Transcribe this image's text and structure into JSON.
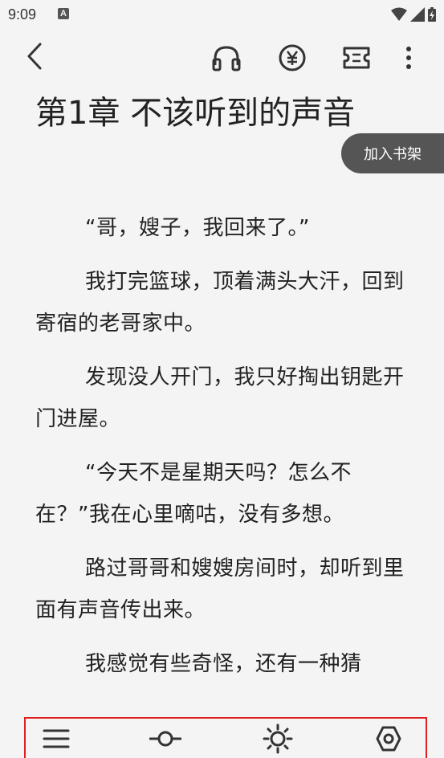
{
  "status": {
    "time": "9:09",
    "a_badge": "A"
  },
  "toolbar": {
    "back_icon": "chevron-left-icon",
    "listen_icon": "headphones-icon",
    "reward_icon": "yuan-coin-icon",
    "ticket_icon": "ticket-icon",
    "more_icon": "more-vertical-icon"
  },
  "chapter": {
    "title": "第1章 不该听到的声音",
    "add_to_shelf": "加入书架",
    "paragraphs": [
      "“哥，嫂子，我回来了。”",
      "我打完篮球，顶着满头大汗，回到寄宿的老哥家中。",
      "发现没人开门，我只好掏出钥匙开门进屋。",
      "“今天不是星期天吗？怎么不在？”我在心里嘀咕，没有多想。",
      "路过哥哥和嫂嫂房间时，却听到里面有声音传出来。",
      "我感觉有些奇怪，还有一种猜"
    ]
  },
  "bottom_nav": {
    "items": [
      "menu-icon",
      "progress-icon",
      "brightness-icon",
      "settings-icon"
    ],
    "highlight_color": "#e02020"
  }
}
